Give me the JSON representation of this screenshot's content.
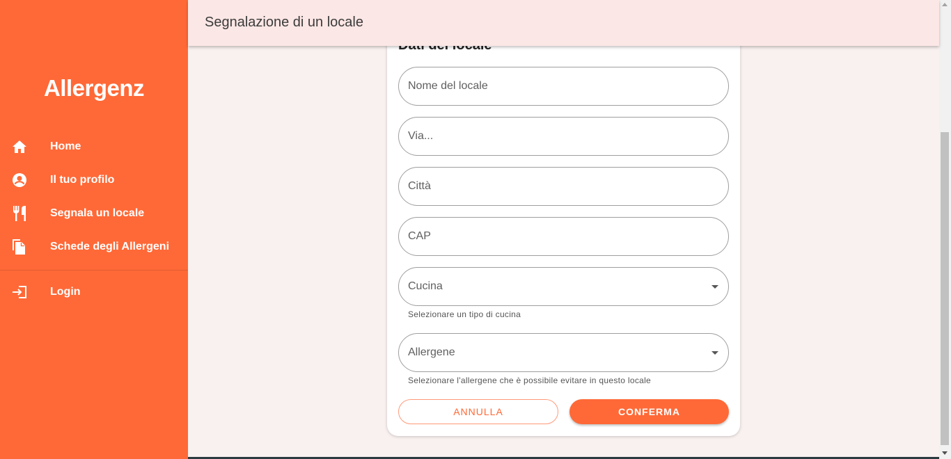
{
  "app": {
    "logo": "Allergenz"
  },
  "sidebar": {
    "items": [
      {
        "label": "Home",
        "icon": "home-icon"
      },
      {
        "label": "Il tuo profilo",
        "icon": "account-circle-icon"
      },
      {
        "label": "Segnala un locale",
        "icon": "restaurant-icon"
      },
      {
        "label": "Schede degli Allergeni",
        "icon": "file-copy-icon"
      }
    ],
    "login": {
      "label": "Login",
      "icon": "login-icon"
    }
  },
  "header": {
    "title": "Segnalazione di un locale"
  },
  "form": {
    "title": "Dati del locale",
    "nome": {
      "placeholder": "Nome del locale"
    },
    "via": {
      "placeholder": "Via..."
    },
    "citta": {
      "placeholder": "Città"
    },
    "cap": {
      "placeholder": "CAP"
    },
    "cucina": {
      "label": "Cucina",
      "hint": "Selezionare un tipo di cucina"
    },
    "allergene": {
      "label": "Allergene",
      "hint": "Selezionare l'allergene che è possibile evitare in questo locale"
    },
    "cancel_label": "ANNULLA",
    "confirm_label": "CONFERMA"
  },
  "colors": {
    "primary": "#ff6937",
    "header_bg": "#fbe7e5",
    "page_bg": "#f9f1f0"
  }
}
